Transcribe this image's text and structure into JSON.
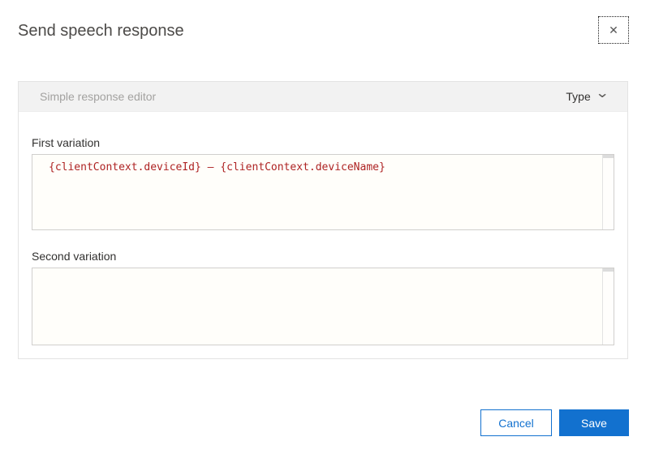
{
  "dialog": {
    "title": "Send speech response"
  },
  "icons": {
    "close_glyph": "✕",
    "chevron_down_glyph": "⌄"
  },
  "editor_panel": {
    "header_label": "Simple response editor",
    "type_dropdown_label": "Type"
  },
  "fields": {
    "first": {
      "label": "First variation",
      "value": "{clientContext.deviceId} – {clientContext.deviceName}"
    },
    "second": {
      "label": "Second variation",
      "value": ""
    }
  },
  "footer": {
    "cancel_label": "Cancel",
    "save_label": "Save"
  },
  "colors": {
    "accent_blue": "#1271cf",
    "code_text_red": "#ae2323",
    "panel_header_bg": "#f2f2f2",
    "panel_border": "#e3e3e3",
    "editor_bg": "#fffefa"
  }
}
